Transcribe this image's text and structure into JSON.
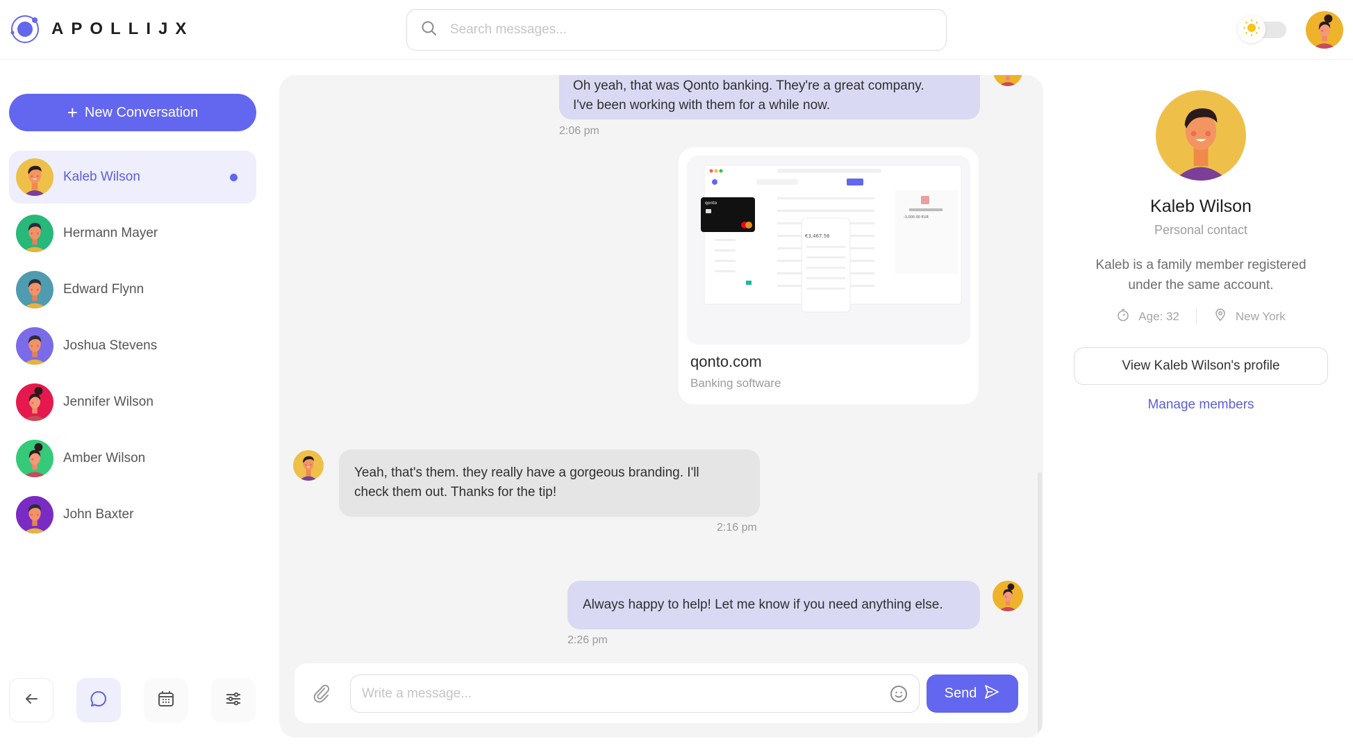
{
  "app": {
    "name": "APOLLIJX",
    "brand_color": "#6366ee"
  },
  "header": {
    "search_placeholder": "Search messages...",
    "theme_mode": "light"
  },
  "sidebar": {
    "new_conversation_label": "New Conversation",
    "contacts": [
      {
        "name": "Kaleb Wilson",
        "active": true,
        "unread": true,
        "avatar_bg": "#eec04a"
      },
      {
        "name": "Hermann Mayer",
        "active": false,
        "unread": false,
        "avatar_bg": "#27b87a"
      },
      {
        "name": "Edward Flynn",
        "active": false,
        "unread": false,
        "avatar_bg": "#4f9bb0"
      },
      {
        "name": "Joshua Stevens",
        "active": false,
        "unread": false,
        "avatar_bg": "#7b6be8"
      },
      {
        "name": "Jennifer Wilson",
        "active": false,
        "unread": false,
        "avatar_bg": "#e5194d"
      },
      {
        "name": "Amber Wilson",
        "active": false,
        "unread": false,
        "avatar_bg": "#35c97a"
      },
      {
        "name": "John Baxter",
        "active": false,
        "unread": false,
        "avatar_bg": "#7a2bc4"
      }
    ],
    "bottom_nav": [
      "back",
      "messages",
      "calendar",
      "settings"
    ]
  },
  "chat": {
    "messages": [
      {
        "sender": "me",
        "text_line1": "Oh yeah, that was Qonto banking. They're a great company.",
        "text_line2": "I've been working with them for a while now.",
        "time": "2:06 pm"
      },
      {
        "sender": "me",
        "type": "link",
        "link_title": "qonto.com",
        "link_subtitle": "Banking software",
        "preview_balance": "€3,467.56",
        "preview_amount": "-3,000.00 EUR",
        "preview_brand": "qonto"
      },
      {
        "sender": "them",
        "text_line1": "Yeah, that's them. they really have a gorgeous branding. I'll",
        "text_line2": "check them out. Thanks for the tip!",
        "time": "2:16 pm"
      },
      {
        "sender": "me",
        "text_line1": "Always happy to help! Let me know if you need anything else.",
        "time": "2:26 pm"
      }
    ],
    "composer": {
      "placeholder": "Write a message...",
      "send_label": "Send"
    }
  },
  "profile": {
    "name": "Kaleb Wilson",
    "role": "Personal contact",
    "description": "Kaleb is a family member registered under the same account.",
    "age": "Age: 32",
    "location": "New York",
    "view_profile_label": "View Kaleb Wilson's profile",
    "manage_members_label": "Manage members"
  }
}
